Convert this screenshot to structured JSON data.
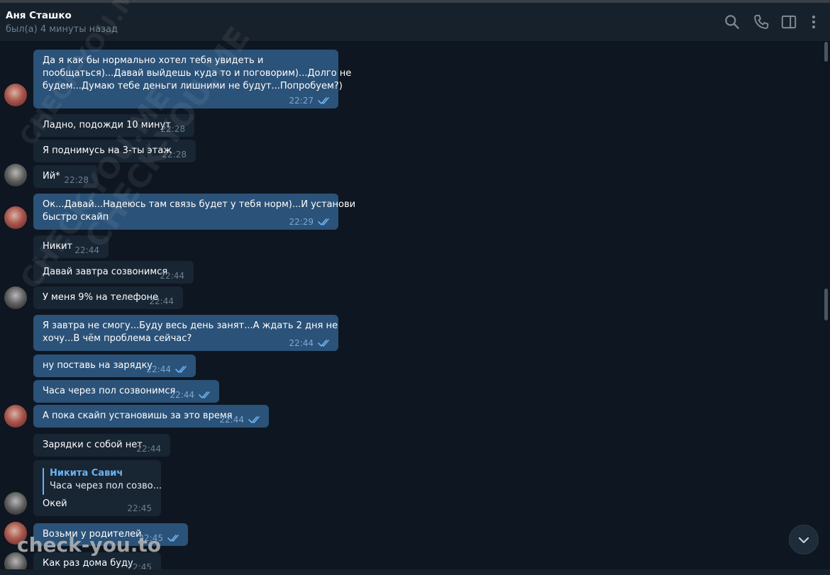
{
  "header": {
    "name": "Аня Сташко",
    "status": "был(а) 4 минуты назад",
    "icons": [
      "search-icon",
      "phone-icon",
      "sidebar-toggle-icon",
      "more-vertical-icon"
    ]
  },
  "colors": {
    "background": "#0e1621",
    "header_bg": "#17212b",
    "incoming_bubble": "#182533",
    "outgoing_bubble": "#2b5278",
    "time_in": "#6d7f8f",
    "time_out": "#7da8d3",
    "link_accent": "#6ab3f3"
  },
  "messages": [
    {
      "dir": "out",
      "text": "Да я как бы нормально хотел тебя увидеть и\nпообщаться)...Давай выйдешь куда то и поговорим)...Долго не\nбудем...Думаю тебе деньги лишними не будут...Попробуем?)",
      "time": "22:27",
      "read": true
    },
    {
      "dir": "in",
      "text": "Ладно, подожди 10 минут",
      "time": "22:28"
    },
    {
      "dir": "in",
      "text": "Я поднимусь на 3-ты этаж",
      "time": "22:28"
    },
    {
      "dir": "in",
      "text": "Ий*",
      "time": "22:28"
    },
    {
      "dir": "out",
      "text": "Ок...Давай...Надеюсь там связь будет у тебя норм)...И установи\nбыстро скайп",
      "time": "22:29",
      "read": true
    },
    {
      "dir": "in",
      "text": "Никит",
      "time": "22:44"
    },
    {
      "dir": "in",
      "text": "Давай завтра созвонимся",
      "time": "22:44"
    },
    {
      "dir": "in",
      "text": "У меня 9% на телефоне",
      "time": "22:44"
    },
    {
      "dir": "out",
      "text": "Я завтра не смогу...Буду весь день занят...А ждать 2 дня не\nхочу...В чём проблема сейчас?",
      "time": "22:44",
      "read": true
    },
    {
      "dir": "out",
      "text": "ну поставь на зарядку",
      "time": "22:44",
      "read": true
    },
    {
      "dir": "out",
      "text": "Часа через пол созвонимся",
      "time": "22:44",
      "read": true
    },
    {
      "dir": "out",
      "text": "А пока скайп установишь за это время",
      "time": "22:44",
      "read": true
    },
    {
      "dir": "in",
      "text": "Зарядки с собой нет",
      "time": "22:44"
    },
    {
      "dir": "in",
      "text": "Окей",
      "time": "22:45",
      "reply": {
        "name": "Никита Савич",
        "text": "Часа через пол созво..."
      }
    },
    {
      "dir": "out",
      "text": "Возьми у родителей",
      "time": "22:45",
      "read": true
    },
    {
      "dir": "in",
      "text": "Как раз дома буду",
      "time": "22:45"
    }
  ],
  "watermarks": {
    "diagonal": [
      "CHECK-YOU.ME",
      "CHECK-YOU.ME",
      "CHECK-YOU.ME"
    ],
    "logo": "check-you.to"
  },
  "scroll_down_icon": "chevron-down-icon"
}
